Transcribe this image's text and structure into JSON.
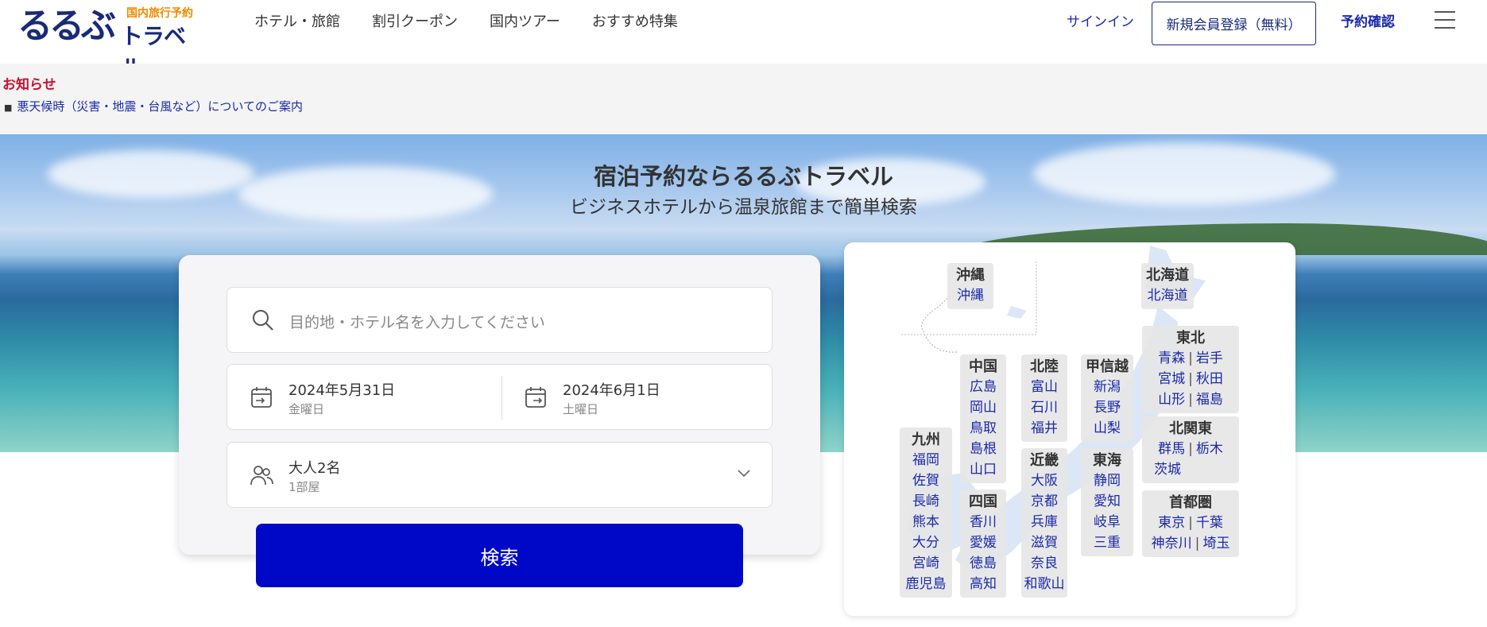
{
  "header": {
    "logo_main": "るるぶ",
    "logo_sub": "国内旅行予約",
    "logo_travel": "トラベル",
    "nav": [
      "ホテル・旅館",
      "割引クーポン",
      "国内ツアー",
      "おすすめ特集"
    ],
    "signin": "サインイン",
    "register": "新規会員登録（無料）",
    "reserve": "予約確認"
  },
  "notice": {
    "title": "お知らせ",
    "bullet": "■",
    "item": "悪天候時（災害・地震・台風など）についてのご案内"
  },
  "hero": {
    "title": "宿泊予約ならるるぶトラベル",
    "subtitle": "ビジネスホテルから温泉旅館まで簡単検索"
  },
  "search": {
    "destination_placeholder": "目的地・ホテル名を入力してください",
    "checkin_date": "2024年5月31日",
    "checkin_day": "金曜日",
    "checkout_date": "2024年6月1日",
    "checkout_day": "土曜日",
    "guests": "大人2名",
    "rooms": "1部屋",
    "button": "検索"
  },
  "map": {
    "okinawa": {
      "name": "沖縄",
      "prefs": [
        "沖縄"
      ]
    },
    "hokkaido": {
      "name": "北海道",
      "prefs": [
        "北海道"
      ]
    },
    "tohoku": {
      "name": "東北",
      "rows": [
        [
          "青森",
          "岩手"
        ],
        [
          "宮城",
          "秋田"
        ],
        [
          "山形",
          "福島"
        ]
      ]
    },
    "kitakanto": {
      "name": "北関東",
      "rows": [
        [
          "群馬",
          "栃木"
        ],
        [
          "茨城"
        ]
      ]
    },
    "shutoken": {
      "name": "首都圏",
      "rows": [
        [
          "東京",
          "千葉"
        ],
        [
          "神奈川",
          "埼玉"
        ]
      ]
    },
    "chugoku": {
      "name": "中国",
      "prefs": [
        "広島",
        "岡山",
        "鳥取",
        "島根",
        "山口"
      ]
    },
    "hokuriku": {
      "name": "北陸",
      "prefs": [
        "富山",
        "石川",
        "福井"
      ]
    },
    "koshinetsu": {
      "name": "甲信越",
      "prefs": [
        "新潟",
        "長野",
        "山梨"
      ]
    },
    "kinki": {
      "name": "近畿",
      "prefs": [
        "大阪",
        "京都",
        "兵庫",
        "滋賀",
        "奈良",
        "和歌山"
      ]
    },
    "tokai": {
      "name": "東海",
      "prefs": [
        "静岡",
        "愛知",
        "岐阜",
        "三重"
      ]
    },
    "shikoku": {
      "name": "四国",
      "prefs": [
        "香川",
        "愛媛",
        "徳島",
        "高知"
      ]
    },
    "kyushu": {
      "name": "九州",
      "prefs": [
        "福岡",
        "佐賀",
        "長崎",
        "熊本",
        "大分",
        "宮崎",
        "鹿児島"
      ]
    }
  }
}
